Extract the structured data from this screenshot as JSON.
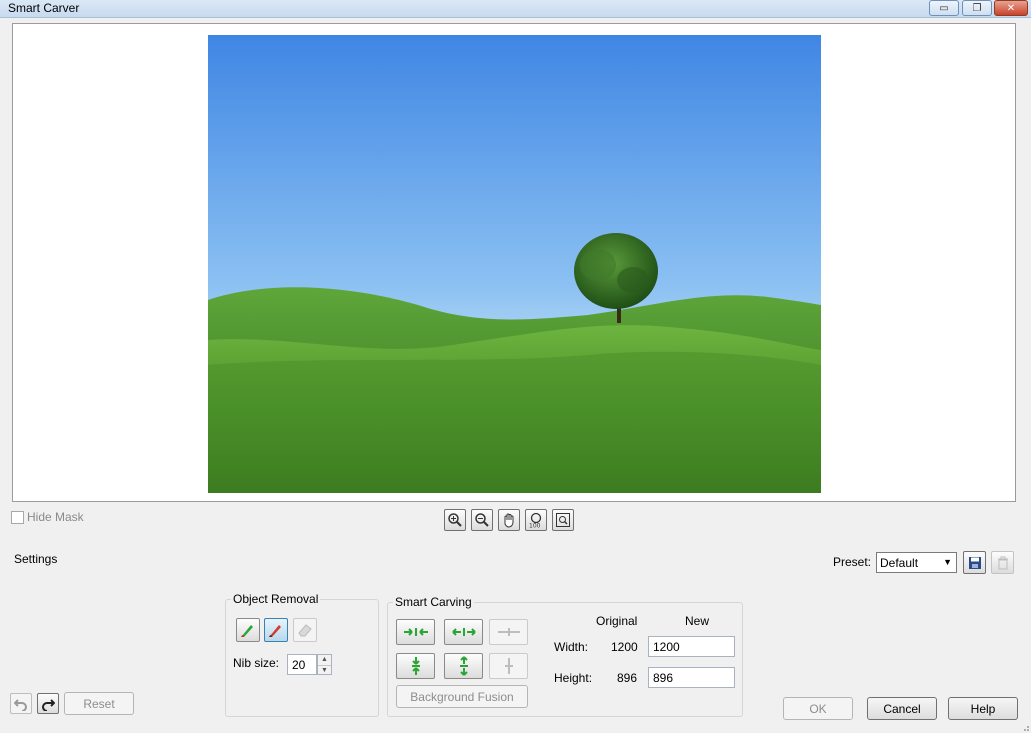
{
  "window": {
    "title": "Smart Carver",
    "minimize_glyph": "▭",
    "restore_glyph": "❐",
    "close_glyph": "✕"
  },
  "canvas": {
    "image_description_icon": "landscape-image"
  },
  "hide_mask": {
    "label": "Hide Mask",
    "checked": false
  },
  "zoom_tools": [
    "zoom-in-icon",
    "zoom-out-icon",
    "pan-hand-icon",
    "zoom-100-icon",
    "fit-to-window-icon"
  ],
  "settings": {
    "title": "Settings",
    "preset_label": "Preset:",
    "preset_value": "Default"
  },
  "object_removal": {
    "title": "Object Removal",
    "nib_label": "Nib size:",
    "nib_value": "20"
  },
  "smart_carving": {
    "title": "Smart Carving",
    "background_fusion": "Background Fusion",
    "original_header": "Original",
    "new_header": "New",
    "width_label": "Width:",
    "height_label": "Height:",
    "width_original": "1200",
    "height_original": "896",
    "width_new": "1200",
    "height_new": "896"
  },
  "footer": {
    "reset": "Reset",
    "ok": "OK",
    "cancel": "Cancel",
    "help": "Help"
  },
  "colors": {
    "accent": "#3c7fb1",
    "green_arrow": "#2aa534"
  }
}
